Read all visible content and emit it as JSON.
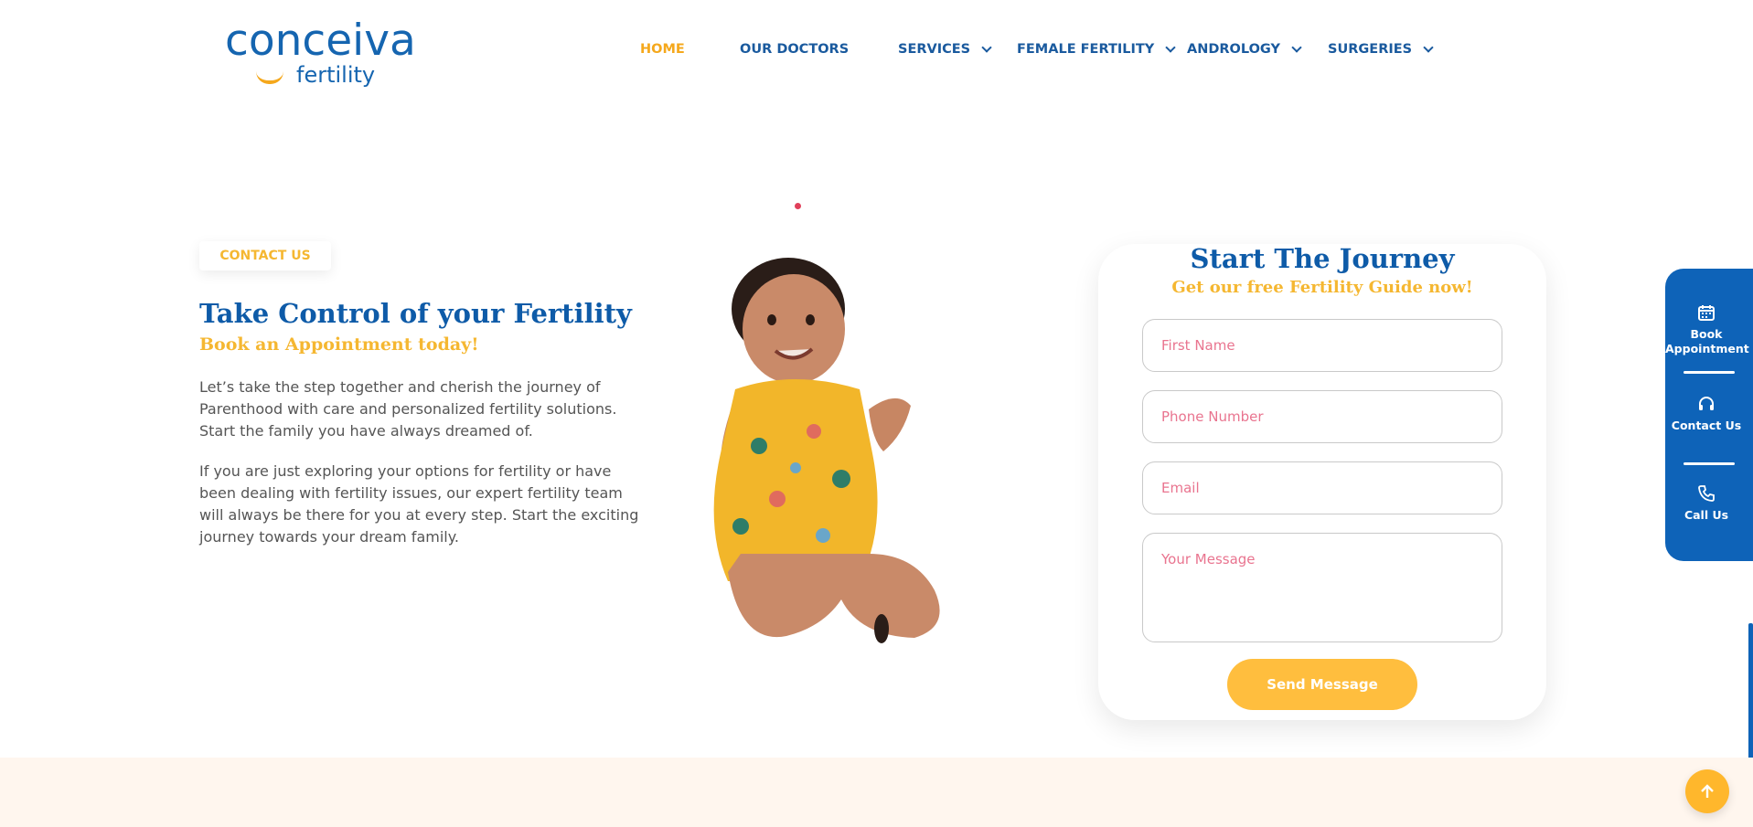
{
  "header": {
    "logo_word": "conceiva",
    "logo_sub": "fertility",
    "nav": [
      {
        "label": "HOME",
        "active": true,
        "dropdown": false
      },
      {
        "label": "OUR DOCTORS",
        "active": false,
        "dropdown": false
      },
      {
        "label": "SERVICES",
        "active": false,
        "dropdown": true
      },
      {
        "label": "FEMALE FERTILITY",
        "active": false,
        "dropdown": true
      },
      {
        "label": "ANDROLOGY",
        "active": false,
        "dropdown": true
      },
      {
        "label": "SURGERIES",
        "active": false,
        "dropdown": true
      }
    ]
  },
  "contact": {
    "tag": "CONTACT US",
    "heading": "Take Control of your Fertility",
    "subheading": "Book an Appointment today!",
    "paragraph_1": "Let’s take the step together and cherish the journey of Parenthood with care and personalized fertility solutions. Start the family you have always dreamed of.",
    "paragraph_2": "If you are just exploring your options for fertility or have been dealing with fertility issues, our expert fertility team will always be there for you at every step. Start the exciting journey towards your dream family."
  },
  "form": {
    "title": "Start The Journey",
    "subtitle": "Get our free Fertility Guide now!",
    "first_name_placeholder": "First Name",
    "phone_placeholder": "Phone Number",
    "email_placeholder": "Email",
    "message_placeholder": "Your Message",
    "submit_label": "Send Message"
  },
  "side_panel": {
    "book": "Book Appointment",
    "contact": "Contact Us",
    "call": "Call Us"
  },
  "colors": {
    "brand_blue": "#0e5ba8",
    "accent_yellow": "#f5b731",
    "placeholder_pink": "#e9748f",
    "band_bg": "#fff6ee"
  },
  "icons": [
    "calendar-icon",
    "headset-icon",
    "phone-icon",
    "arrow-up-icon",
    "chevron-down-icon"
  ]
}
